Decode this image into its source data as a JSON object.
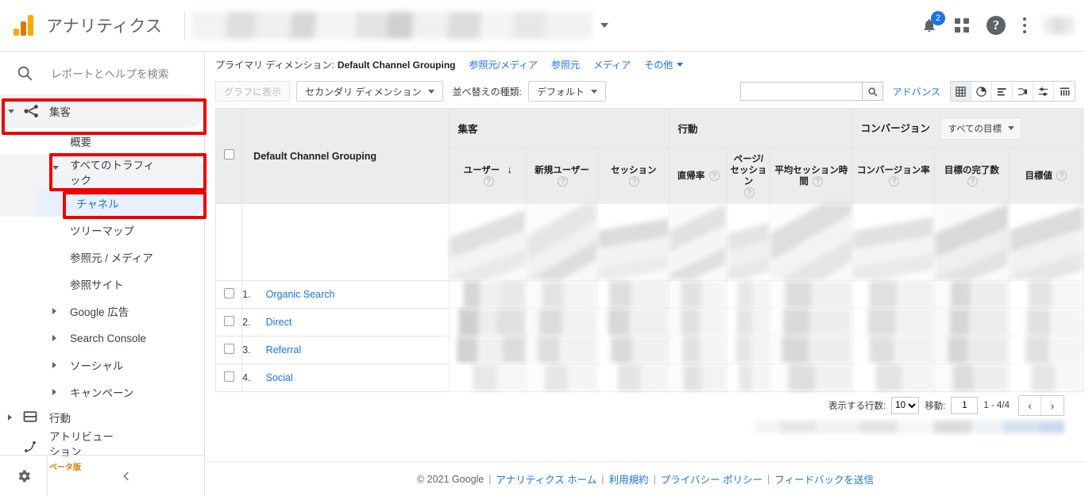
{
  "header": {
    "product_title": "アナリティクス",
    "logo_icon": "analytics-logo-icon",
    "property_caret_icon": "chevron-down-icon",
    "notifications_icon": "bell-icon",
    "notifications_count": "2",
    "apps_icon": "apps-grid-icon",
    "help_icon": "help-circle-icon",
    "more_icon": "kebab-menu-icon",
    "avatar_icon": "avatar"
  },
  "sidebar": {
    "search_placeholder": "レポートとヘルプを検索",
    "search_icon": "search-icon",
    "acquisition": {
      "label": "集客",
      "icon": "acquisition-icon"
    },
    "items": [
      {
        "label": "概要"
      },
      {
        "label": "すべてのトラフィック"
      },
      {
        "label": "チャネル"
      },
      {
        "label": "ツリーマップ"
      },
      {
        "label": "参照元 / メディア"
      },
      {
        "label": "参照サイト"
      },
      {
        "label": "Google 広告"
      },
      {
        "label": "Search Console"
      },
      {
        "label": "ソーシャル"
      },
      {
        "label": "キャンペーン"
      }
    ],
    "behavior": {
      "label": "行動",
      "icon": "behavior-icon"
    },
    "attribution": {
      "label": "アトリビューション",
      "badge": "ベータ版",
      "icon": "attribution-icon"
    },
    "settings_icon": "gear-icon",
    "collapse_icon": "chevron-left-icon"
  },
  "dimension_bar": {
    "label": "プライマリ ディメンション:",
    "active": "Default Channel Grouping",
    "links": [
      "参照元/メディア",
      "参照元",
      "メディア"
    ],
    "more": "その他",
    "more_icon": "chevron-down-icon"
  },
  "controls": {
    "plot_rows": "グラフに表示",
    "secondary_dimension": "セカンダリ ディメンション",
    "sort_type_label": "並べ替えの種類:",
    "sort_type_value": "デフォルト",
    "search_value": "",
    "search_icon": "search-icon",
    "advanced": "アドバンス",
    "view_icons": [
      "table-view-icon",
      "pie-view-icon",
      "bar-view-icon",
      "flow-view-icon",
      "comparison-view-icon",
      "pivot-view-icon"
    ]
  },
  "table": {
    "dimension_header": "Default Channel Grouping",
    "groups": {
      "acquisition": "集客",
      "behavior": "行動",
      "conversion": "コンバージョン",
      "goal_selector": "すべての目標",
      "goal_selector_icon": "chevron-down-icon"
    },
    "columns": [
      {
        "label": "ユーザー",
        "help": "?",
        "sorted": true,
        "sort_icon": "arrow-down-icon"
      },
      {
        "label": "新規ユーザー",
        "help": "?"
      },
      {
        "label": "セッション",
        "help": "?"
      },
      {
        "label": "直帰率",
        "help": "?"
      },
      {
        "label": "ページ/セッション",
        "help": "?"
      },
      {
        "label": "平均セッション時間",
        "help": "?"
      },
      {
        "label": "コンバージョン率",
        "help": "?"
      },
      {
        "label": "目標の完了数",
        "help": "?"
      },
      {
        "label": "目標値",
        "help": "?"
      }
    ],
    "rows": [
      {
        "index": "1.",
        "name": "Organic Search"
      },
      {
        "index": "2.",
        "name": "Direct"
      },
      {
        "index": "3.",
        "name": "Referral"
      },
      {
        "index": "4.",
        "name": "Social"
      }
    ]
  },
  "pagination": {
    "rows_label": "表示する行数:",
    "rows_value": "10",
    "goto_label": "移動:",
    "goto_value": "1",
    "range": "1 - 4/4",
    "prev_icon": "chevron-left-icon",
    "next_icon": "chevron-right-icon"
  },
  "footer": {
    "copyright": "© 2021 Google",
    "links": [
      "アナリティクス ホーム",
      "利用規約",
      "プライバシー ポリシー",
      "フィードバックを送信"
    ]
  }
}
